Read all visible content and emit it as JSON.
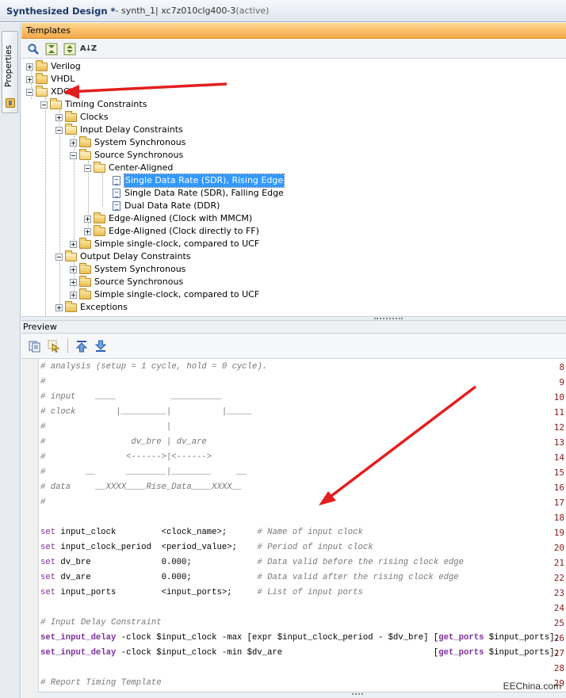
{
  "window": {
    "title_bold": "Synthesized Design *",
    "title_synth": " - synth_1",
    "title_part": " | xc7z010clg400-3",
    "title_status": " (active)"
  },
  "side_tab": {
    "label": "Properties"
  },
  "templates": {
    "header": "Templates",
    "toolbar": {
      "search_icon": "search-icon",
      "collapse_icon": "collapse-all-icon",
      "expand_icon": "expand-all-icon",
      "sort_label": "A↓Z"
    },
    "tree": [
      {
        "label": "Verilog"
      },
      {
        "label": "VHDL"
      },
      {
        "label": "XDC"
      },
      {
        "label": "Timing Constraints"
      },
      {
        "label": "Clocks"
      },
      {
        "label": "Input Delay Constraints"
      },
      {
        "label": "System Synchronous"
      },
      {
        "label": "Source Synchronous"
      },
      {
        "label": "Center-Aligned"
      },
      {
        "label": "Single Data Rate (SDR), Rising Edge"
      },
      {
        "label": "Single Data Rate (SDR), Falling Edge"
      },
      {
        "label": "Dual Data Rate (DDR)"
      },
      {
        "label": "Edge-Aligned (Clock with MMCM)"
      },
      {
        "label": "Edge-Aligned (Clock directly to FF)"
      },
      {
        "label": "Simple single-clock, compared to UCF"
      },
      {
        "label": "Output Delay Constraints"
      },
      {
        "label": "System Synchronous"
      },
      {
        "label": "Source Synchronous"
      },
      {
        "label": "Simple single-clock, compared to UCF"
      },
      {
        "label": "Exceptions"
      }
    ]
  },
  "preview": {
    "header": "Preview",
    "line_numbers": [
      "8",
      "9",
      "10",
      "11",
      "12",
      "13",
      "14",
      "15",
      "16",
      "17",
      "18",
      "19",
      "20",
      "21",
      "22",
      "23",
      "24",
      "25",
      "26",
      "27",
      "28",
      "29"
    ],
    "code": {
      "l8": "# analysis (setup = 1 cycle, hold = 0 cycle).",
      "l9": "#",
      "l10": "# input    ____           __________",
      "l11": "# clock        |_________|          |_____",
      "l12": "#                        |",
      "l13": "#                 dv_bre | dv_are",
      "l14": "#                <------>|<------>",
      "l15": "#        __      ________|________     __",
      "l16": "# data     __XXXX____Rise_Data____XXXX__",
      "l17": "#",
      "l19_kw": "set",
      "l19_rest": " input_clock         <clock_name>;      ",
      "l19_cm": "# Name of input clock",
      "l20_kw": "set",
      "l20_rest": " input_clock_period  <period_value>;    ",
      "l20_cm": "# Period of input clock",
      "l21_kw": "set",
      "l21_rest": " dv_bre              0.000;             ",
      "l21_cm": "# Data valid before the rising clock edge",
      "l22_kw": "set",
      "l22_rest": " dv_are              0.000;             ",
      "l22_cm": "# Data valid after the rising clock edge",
      "l23_kw": "set",
      "l23_rest": " input_ports         <input_ports>;     ",
      "l23_cm": "# List of input ports",
      "l25": "# Input Delay Constraint",
      "l26_kw": "set_input_delay",
      "l26_mid": " -clock $input_clock -max [expr $input_clock_period - $dv_bre] [",
      "l26_kw2": "get_ports",
      "l26_end": " $input_ports];",
      "l27_kw": "set_input_delay",
      "l27_mid": " -clock $input_clock -min $dv_are                              [",
      "l27_kw2": "get_ports",
      "l27_end": " $input_ports];",
      "l29": "# Report Timing Template"
    }
  },
  "watermark": "EEChina.com",
  "colors": {
    "header_orange": "#f5a94a",
    "selection": "#3399ff",
    "arrow": "#e41e1e",
    "keyword": "#7b2e9b"
  }
}
